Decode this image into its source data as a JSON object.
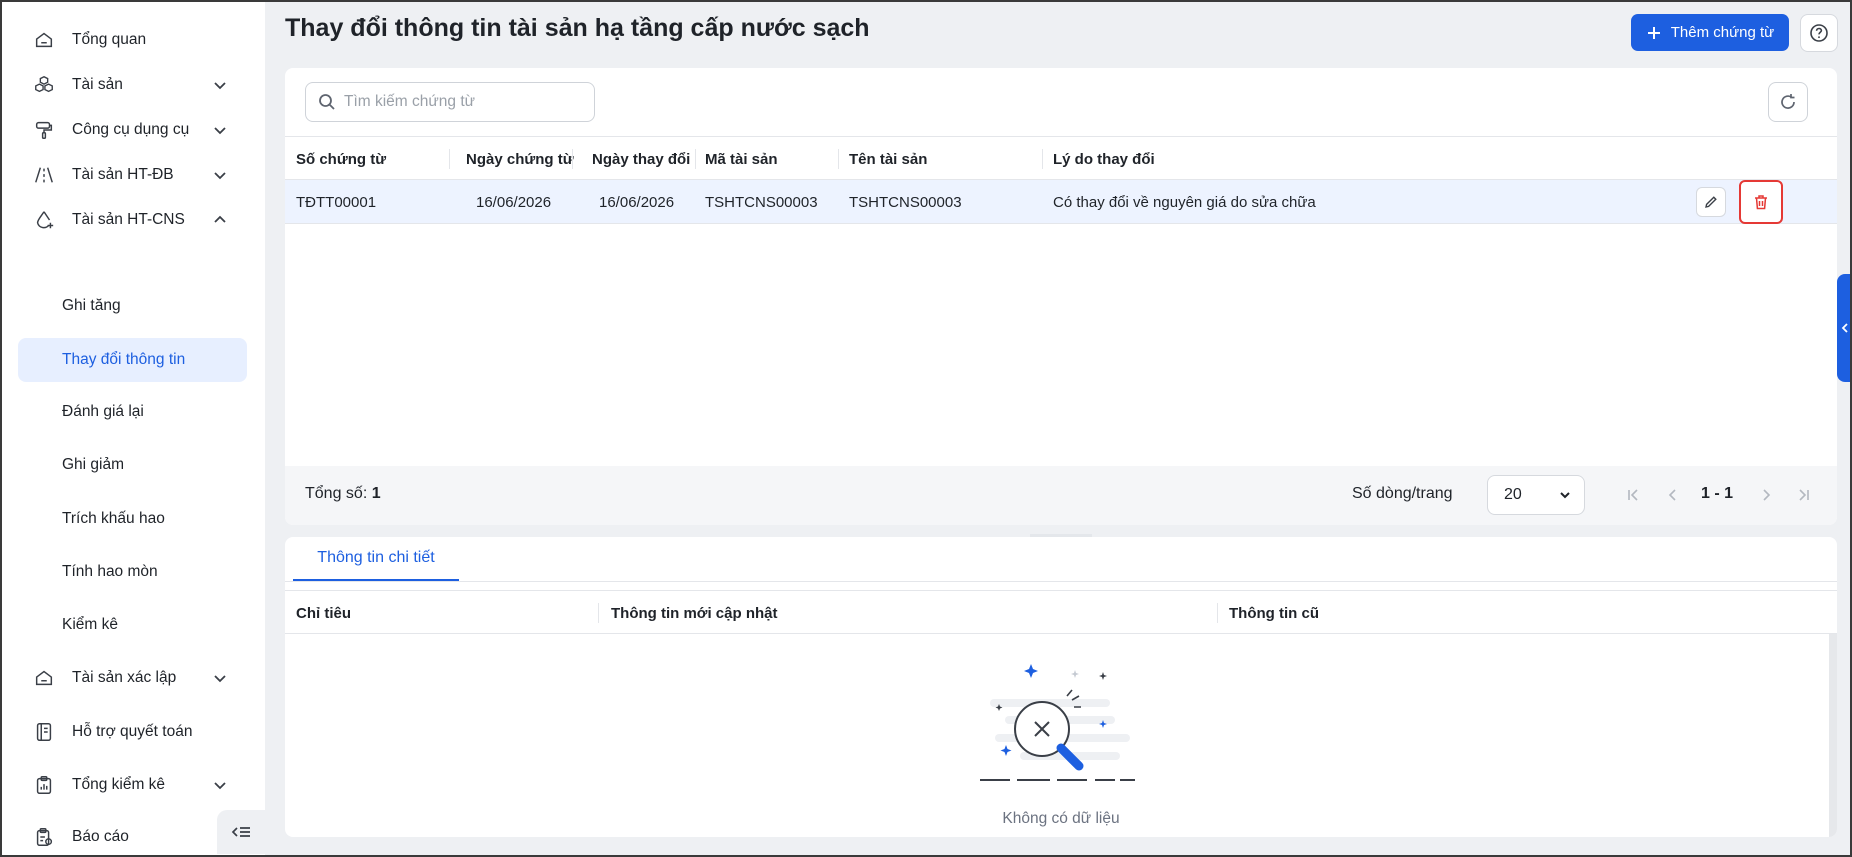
{
  "sidebar": {
    "items": [
      {
        "label": "Tổng quan",
        "icon": "home-icon"
      },
      {
        "label": "Tài sản",
        "icon": "cubes-icon"
      },
      {
        "label": "Công cụ dụng cụ",
        "icon": "paint-roller-icon"
      },
      {
        "label": "Tài sản HT-ĐB",
        "icon": "road-icon"
      },
      {
        "label": "Tài sản HT-CNS",
        "icon": "water-drop-icon"
      }
    ],
    "sub_items": [
      "Ghi tăng",
      "Thay đổi thông tin",
      "Đánh giá lại",
      "Ghi giảm",
      "Trích khấu hao",
      "Tính hao mòn",
      "Kiểm kê"
    ],
    "active_sub": "Thay đổi thông tin",
    "bottom_items": [
      {
        "label": "Tài sản xác lập",
        "icon": "home-icon"
      },
      {
        "label": "Hỗ trợ quyết toán",
        "icon": "ledger-icon"
      },
      {
        "label": "Tổng kiểm kê",
        "icon": "clipboard-icon"
      },
      {
        "label": "Báo cáo",
        "icon": "report-icon"
      }
    ]
  },
  "header": {
    "title": "Thay đổi thông tin tài sản hạ tầng cấp nước sạch",
    "add_label": "Thêm chứng từ"
  },
  "search": {
    "placeholder": "Tìm kiếm chứng từ"
  },
  "table": {
    "columns": [
      "Số chứng từ",
      "Ngày chứng từ",
      "Ngày thay đổi",
      "Mã tài sản",
      "Tên tài sản",
      "Lý do thay đổi"
    ],
    "rows": [
      [
        "TĐTT00001",
        "16/06/2026",
        "16/06/2026",
        "TSHTCNS00003",
        "TSHTCNS00003",
        "Có thay đổi về nguyên giá do sửa chữa"
      ]
    ]
  },
  "footer": {
    "total_label": "Tổng số:",
    "total_value": "1",
    "rows_per_page_label": "Số dòng/trang",
    "rows_per_page": "20",
    "range": "1 - 1"
  },
  "detail": {
    "tab_label": "Thông tin chi tiết",
    "columns": [
      "Chỉ tiêu",
      "Thông tin mới cập nhật",
      "Thông tin cũ"
    ],
    "empty_message": "Không có dữ liệu"
  },
  "colors": {
    "accent": "#1d5fe0",
    "delete_highlight": "#e53935",
    "selected_row": "#edf3ff"
  }
}
